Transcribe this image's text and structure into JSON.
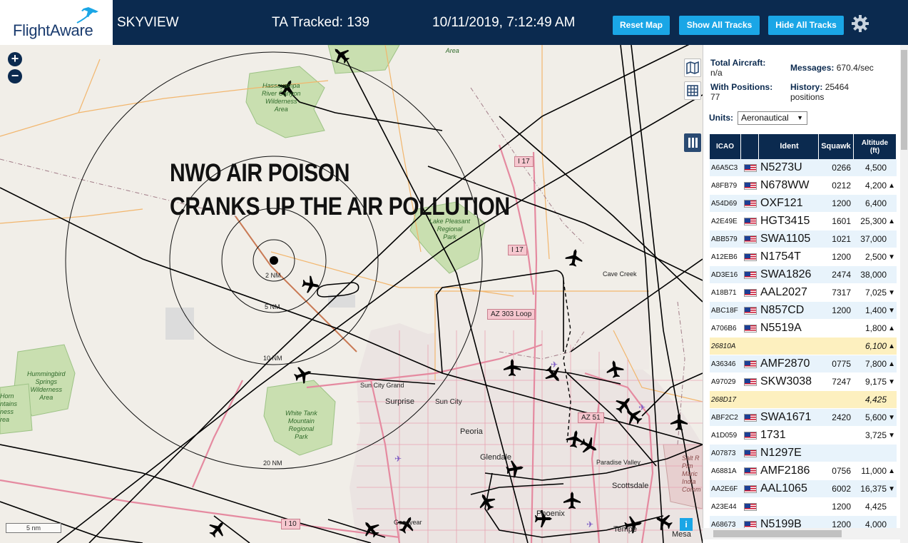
{
  "header": {
    "logo_text": "FlightAware",
    "app_title": "SKYVIEW",
    "tracked_label": "TA Tracked: 139",
    "datetime": "10/11/2019, 7:12:49 AM",
    "buttons": {
      "reset_map": "Reset Map",
      "show_all_tracks": "Show All Tracks",
      "hide_all_tracks": "Hide All Tracks"
    },
    "settings_icon": "gear-icon",
    "brand_color": "#0b2a4f",
    "button_color": "#1aa6e6"
  },
  "map": {
    "zoom_in": "+",
    "zoom_out": "−",
    "caption_line1": "NWO AIR POISON",
    "caption_line2": "CRANKS UP THE AIR POLLUTION",
    "range_rings": [
      "2 NM",
      "5 NM",
      "10 NM",
      "20 NM"
    ],
    "places": {
      "surprise": "Surprise",
      "sun_city": "Sun City",
      "sun_city_grand": "Sun City Grand",
      "peoria": "Peoria",
      "glendale": "Glendale",
      "phoenix": "Phoenix",
      "scottsdale": "Scottsdale",
      "paradise_valley": "Paradise Valley",
      "cave_creek": "Cave Creek",
      "tempe": "Tempe",
      "mesa": "Mesa",
      "goodyear": "Goodyear"
    },
    "parks": {
      "hassayampa": "Hassayampa\nRiver Canyon\nWilderness\nArea",
      "lake_pleasant": "Lake Pleasant\nRegional\nPark",
      "hummingbird": "Hummingbird\nSprings\nWilderness\nArea",
      "white_tank": "White Tank\nMountain\nRegional\nPark",
      "horn": "Horn\nntains\nness\nrea",
      "top_wilderness": "Wilderness\nArea",
      "salt_river": "Salt R\nPim\nMaric\nIndia\nComm"
    },
    "road_shields": {
      "i17_top": "I 17",
      "i17_mid": "I 17",
      "az303": "AZ 303 Loop",
      "az51": "AZ 51",
      "i10": "I 10"
    },
    "scale_label": "5 nm",
    "info_label": "i",
    "tool_icons": [
      "map-icon",
      "grid-icon",
      "columns-icon"
    ]
  },
  "panel": {
    "total_aircraft_label": "Total Aircraft:",
    "total_aircraft_value": "n/a",
    "with_positions_label": "With Positions:",
    "with_positions_value": "77",
    "messages_label": "Messages:",
    "messages_value": "670.4/sec",
    "history_label": "History:",
    "history_value": "25464",
    "history_unit": "positions",
    "units_label": "Units:",
    "units_value": "Aeronautical",
    "table": {
      "headers": [
        "ICAO",
        "",
        "Ident",
        "Squawk",
        "Altitude\n(ft)"
      ],
      "rows": [
        {
          "icao": "A6A5C3",
          "flag": true,
          "ident": "N5273U",
          "squawk": "0266",
          "alt": "4,500",
          "trend": "",
          "style": "odd"
        },
        {
          "icao": "A8FB79",
          "flag": true,
          "ident": "N678WW",
          "squawk": "0212",
          "alt": "4,200",
          "trend": "▲",
          "style": "even"
        },
        {
          "icao": "A54D69",
          "flag": true,
          "ident": "OXF121",
          "squawk": "1200",
          "alt": "6,400",
          "trend": "",
          "style": "odd"
        },
        {
          "icao": "A2E49E",
          "flag": true,
          "ident": "HGT3415",
          "squawk": "1601",
          "alt": "25,300",
          "trend": "▲",
          "style": "even"
        },
        {
          "icao": "ABB579",
          "flag": true,
          "ident": "SWA1105",
          "squawk": "1021",
          "alt": "37,000",
          "trend": "",
          "style": "odd"
        },
        {
          "icao": "A12EB6",
          "flag": true,
          "ident": "N1754T",
          "squawk": "1200",
          "alt": "2,500",
          "trend": "▼",
          "style": "even"
        },
        {
          "icao": "AD3E16",
          "flag": true,
          "ident": "SWA1826",
          "squawk": "2474",
          "alt": "38,000",
          "trend": "",
          "style": "odd"
        },
        {
          "icao": "A18B71",
          "flag": true,
          "ident": "AAL2027",
          "squawk": "7317",
          "alt": "7,025",
          "trend": "▼",
          "style": "even"
        },
        {
          "icao": "ABC18F",
          "flag": true,
          "ident": "N857CD",
          "squawk": "1200",
          "alt": "1,400",
          "trend": "▼",
          "style": "odd"
        },
        {
          "icao": "A706B6",
          "flag": true,
          "ident": "N5519A",
          "squawk": "",
          "alt": "1,800",
          "trend": "▲",
          "style": "even"
        },
        {
          "icao": "26810A",
          "flag": false,
          "ident": "",
          "squawk": "",
          "alt": "6,100",
          "trend": "▲",
          "style": "hl"
        },
        {
          "icao": "A36346",
          "flag": true,
          "ident": "AMF2870",
          "squawk": "0775",
          "alt": "7,800",
          "trend": "▲",
          "style": "odd"
        },
        {
          "icao": "A97029",
          "flag": true,
          "ident": "SKW3038",
          "squawk": "7247",
          "alt": "9,175",
          "trend": "▼",
          "style": "even"
        },
        {
          "icao": "268D17",
          "flag": false,
          "ident": "",
          "squawk": "",
          "alt": "4,425",
          "trend": "",
          "style": "hl"
        },
        {
          "icao": "ABF2C2",
          "flag": true,
          "ident": "SWA1671",
          "squawk": "2420",
          "alt": "5,600",
          "trend": "▼",
          "style": "odd"
        },
        {
          "icao": "A1D059",
          "flag": true,
          "ident": "1731",
          "squawk": "",
          "alt": "3,725",
          "trend": "▼",
          "style": "even"
        },
        {
          "icao": "A07873",
          "flag": true,
          "ident": "N1297E",
          "squawk": "",
          "alt": "",
          "trend": "",
          "style": "odd"
        },
        {
          "icao": "A6881A",
          "flag": true,
          "ident": "AMF2186",
          "squawk": "0756",
          "alt": "11,000",
          "trend": "▲",
          "style": "even"
        },
        {
          "icao": "AA2E6F",
          "flag": true,
          "ident": "AAL1065",
          "squawk": "6002",
          "alt": "16,375",
          "trend": "▼",
          "style": "odd"
        },
        {
          "icao": "A23E44",
          "flag": true,
          "ident": "",
          "squawk": "1200",
          "alt": "4,425",
          "trend": "",
          "style": "even"
        },
        {
          "icao": "A68673",
          "flag": true,
          "ident": "N5199B",
          "squawk": "1200",
          "alt": "4,000",
          "trend": "",
          "style": "odd"
        }
      ]
    }
  }
}
